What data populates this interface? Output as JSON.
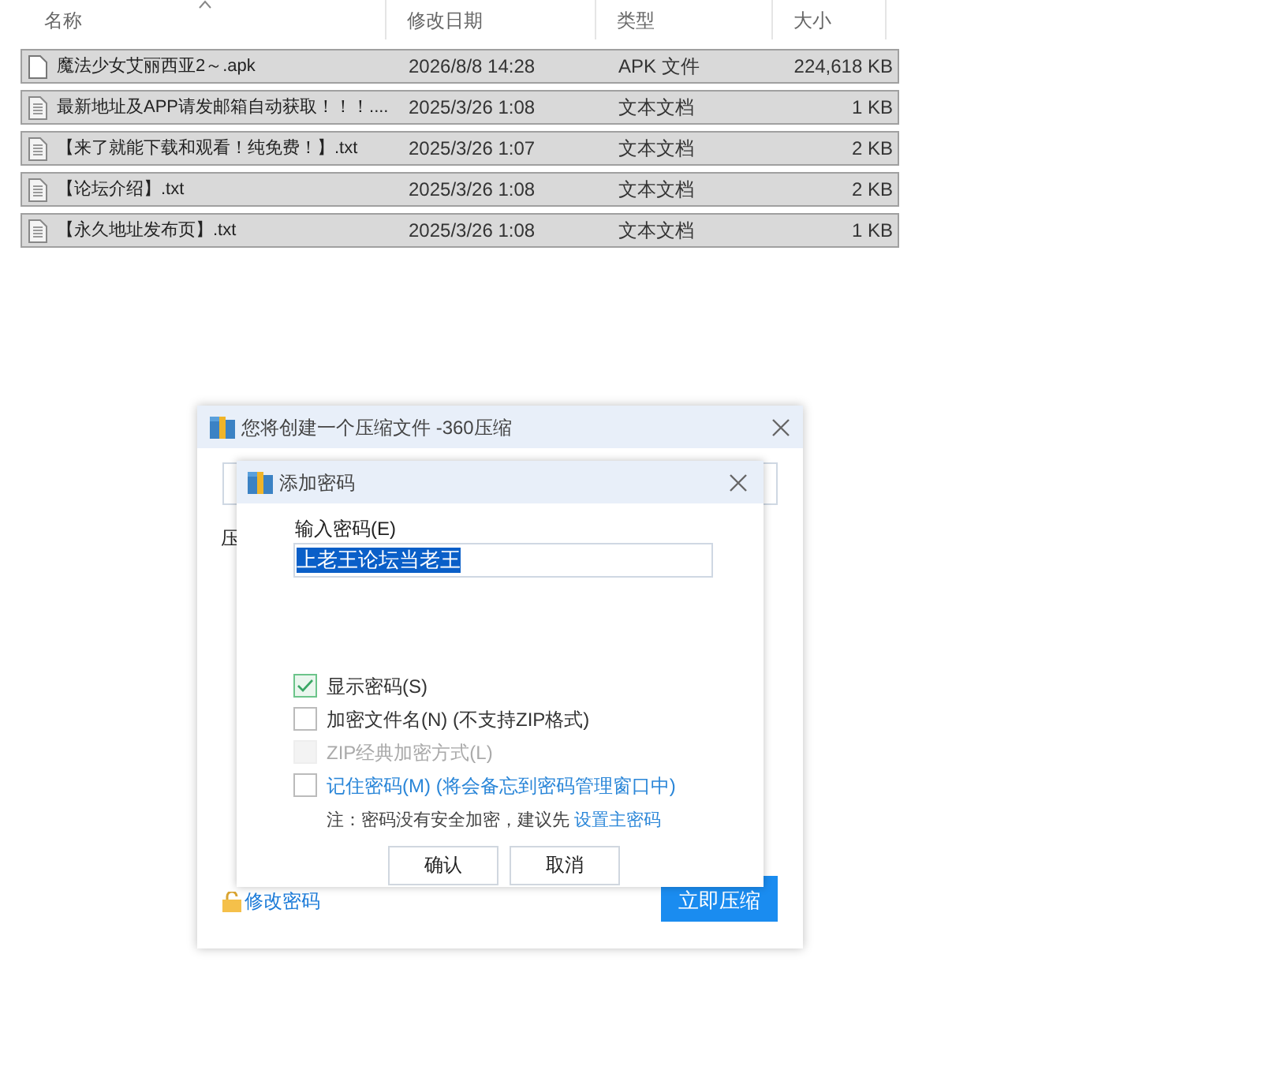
{
  "file_list": {
    "columns": [
      {
        "label": "名称",
        "sorted": true
      },
      {
        "label": "修改日期",
        "sorted": false
      },
      {
        "label": "类型",
        "sorted": false
      },
      {
        "label": "大小",
        "sorted": false
      }
    ],
    "rows": [
      {
        "name": "魔法少女艾丽西亚2～.apk",
        "date": "2026/8/8 14:28",
        "type": "APK 文件",
        "size": "224,618 KB",
        "kind": "apk",
        "selected": true
      },
      {
        "name": "最新地址及APP请发邮箱自动获取！！！....",
        "date": "2025/3/26 1:08",
        "type": "文本文档",
        "size": "1 KB",
        "kind": "txt",
        "selected": true
      },
      {
        "name": "【来了就能下载和观看！纯免费！】.txt",
        "date": "2025/3/26 1:07",
        "type": "文本文档",
        "size": "2 KB",
        "kind": "txt",
        "selected": true
      },
      {
        "name": "【论坛介绍】.txt",
        "date": "2025/3/26 1:08",
        "type": "文本文档",
        "size": "2 KB",
        "kind": "txt",
        "selected": true
      },
      {
        "name": "【永久地址发布页】.txt",
        "date": "2025/3/26 1:08",
        "type": "文本文档",
        "size": "1 KB",
        "kind": "txt",
        "selected": true
      }
    ]
  },
  "compress_dialog": {
    "title": "您将创建一个压缩文件 -360压缩",
    "label_fragment": "压",
    "change_password_link": "修改密码",
    "compress_button": "立即压缩"
  },
  "password_dialog": {
    "title": "添加密码",
    "field_label": "输入密码(E)",
    "password": "上老王论坛当老王",
    "options": [
      {
        "label": "显示密码(S)",
        "checked": true,
        "disabled": false,
        "link": false
      },
      {
        "label": "加密文件名(N) (不支持ZIP格式)",
        "checked": false,
        "disabled": false,
        "link": false
      },
      {
        "label": "ZIP经典加密方式(L)",
        "checked": false,
        "disabled": true,
        "link": false
      },
      {
        "label": "记住密码(M) (将会备忘到密码管理窗口中)",
        "checked": false,
        "disabled": false,
        "link": true
      }
    ],
    "note": "注：密码没有安全加密，建议先",
    "note_link": "设置主密码",
    "buttons": [
      "确认",
      "取消"
    ]
  }
}
